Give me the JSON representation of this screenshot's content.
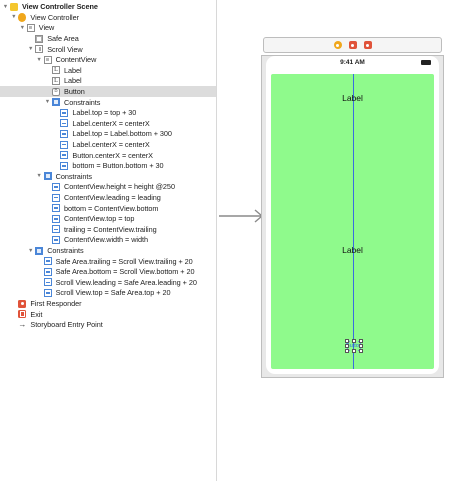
{
  "outline": {
    "rows": [
      {
        "text": "View Controller Scene",
        "disclosure": "▼",
        "icon": "scene-icon",
        "indent": 0,
        "selected": false
      },
      {
        "text": "View Controller",
        "disclosure": "▼",
        "icon": "view-controller-icon",
        "indent": 1,
        "selected": false
      },
      {
        "text": "View",
        "disclosure": "▼",
        "icon": "view-icon",
        "indent": 2,
        "selected": false
      },
      {
        "text": "Safe Area",
        "disclosure": "",
        "icon": "safe-area-icon",
        "indent": 3,
        "selected": false
      },
      {
        "text": "Scroll View",
        "disclosure": "▼",
        "icon": "scroll-view-icon",
        "indent": 3,
        "selected": false
      },
      {
        "text": "ContentView",
        "disclosure": "▼",
        "icon": "view-icon",
        "indent": 4,
        "selected": false
      },
      {
        "text": "Label",
        "disclosure": "",
        "icon": "label-icon",
        "indent": 5,
        "selected": false
      },
      {
        "text": "Label",
        "disclosure": "",
        "icon": "label-icon",
        "indent": 5,
        "selected": false
      },
      {
        "text": "Button",
        "disclosure": "",
        "icon": "button-icon",
        "indent": 5,
        "selected": true
      },
      {
        "text": "Constraints",
        "disclosure": "▼",
        "icon": "constraints-group-icon",
        "indent": 5,
        "selected": false
      },
      {
        "text": "Label.top = top + 30",
        "disclosure": "",
        "icon": "constraint-icon",
        "indent": 6,
        "selected": false
      },
      {
        "text": "Label.centerX = centerX",
        "disclosure": "",
        "icon": "constraint-icon",
        "indent": 6,
        "selected": false
      },
      {
        "text": "Label.top = Label.bottom + 300",
        "disclosure": "",
        "icon": "constraint-icon",
        "indent": 6,
        "selected": false
      },
      {
        "text": "Label.centerX = centerX",
        "disclosure": "",
        "icon": "constraint-icon",
        "indent": 6,
        "selected": false
      },
      {
        "text": "Button.centerX = centerX",
        "disclosure": "",
        "icon": "constraint-icon",
        "indent": 6,
        "selected": false
      },
      {
        "text": "bottom = Button.bottom + 30",
        "disclosure": "",
        "icon": "constraint-icon",
        "indent": 6,
        "selected": false
      },
      {
        "text": "Constraints",
        "disclosure": "▼",
        "icon": "constraints-group-icon",
        "indent": 4,
        "selected": false
      },
      {
        "text": "ContentView.height = height @250",
        "disclosure": "",
        "icon": "constraint-icon",
        "indent": 5,
        "selected": false
      },
      {
        "text": "ContentView.leading = leading",
        "disclosure": "",
        "icon": "constraint-icon",
        "indent": 5,
        "selected": false
      },
      {
        "text": "bottom = ContentView.bottom",
        "disclosure": "",
        "icon": "constraint-icon",
        "indent": 5,
        "selected": false
      },
      {
        "text": "ContentView.top = top",
        "disclosure": "",
        "icon": "constraint-icon",
        "indent": 5,
        "selected": false
      },
      {
        "text": "trailing = ContentView.trailing",
        "disclosure": "",
        "icon": "constraint-icon",
        "indent": 5,
        "selected": false
      },
      {
        "text": "ContentView.width = width",
        "disclosure": "",
        "icon": "constraint-icon",
        "indent": 5,
        "selected": false
      },
      {
        "text": "Constraints",
        "disclosure": "▼",
        "icon": "constraints-group-icon",
        "indent": 3,
        "selected": false
      },
      {
        "text": "Safe Area.trailing = Scroll View.trailing + 20",
        "disclosure": "",
        "icon": "constraint-icon",
        "indent": 4,
        "selected": false
      },
      {
        "text": "Safe Area.bottom = Scroll View.bottom + 20",
        "disclosure": "",
        "icon": "constraint-icon",
        "indent": 4,
        "selected": false
      },
      {
        "text": "Scroll View.leading = Safe Area.leading + 20",
        "disclosure": "",
        "icon": "constraint-icon",
        "indent": 4,
        "selected": false
      },
      {
        "text": "Scroll View.top = Safe Area.top + 20",
        "disclosure": "",
        "icon": "constraint-icon",
        "indent": 4,
        "selected": false
      },
      {
        "text": "First Responder",
        "disclosure": "",
        "icon": "first-responder-icon",
        "indent": 1,
        "selected": false
      },
      {
        "text": "Exit",
        "disclosure": "",
        "icon": "exit-icon",
        "indent": 1,
        "selected": false
      },
      {
        "text": "Storyboard Entry Point",
        "disclosure": "",
        "icon": "entry-point-arrow-icon",
        "indent": 1,
        "selected": false
      }
    ]
  },
  "canvas": {
    "status_time": "9:41 AM",
    "label_top": "Label",
    "label_middle": "Label",
    "button_text": "Button",
    "colors": {
      "content_background": "#8ffa8c",
      "selection_guide": "#3a6ce0",
      "outline_selected_row": "#dcdcdc"
    }
  }
}
